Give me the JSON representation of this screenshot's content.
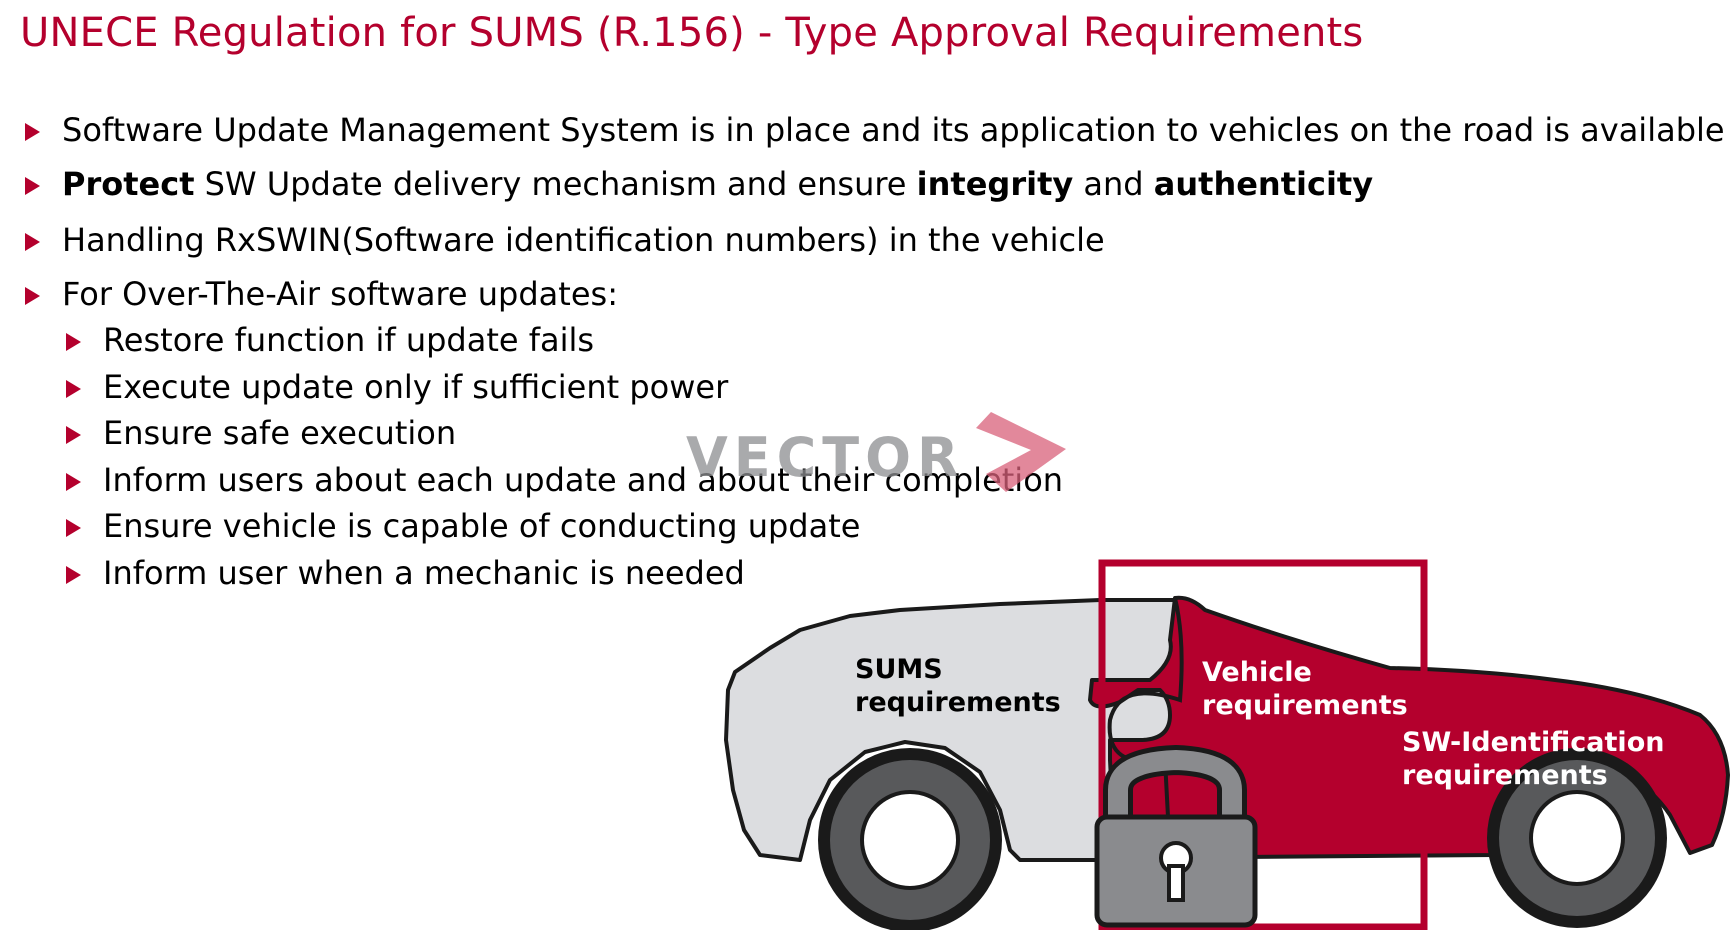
{
  "slide": {
    "title": "UNECE Regulation for SUMS (R.156) - Type Approval Requirements"
  },
  "bullets": {
    "b1": {
      "text": "Software Update Management System is in place and its application to vehicles on the road is available"
    },
    "b2": {
      "protect": "Protect",
      "mid": " SW Update delivery mechanism and ensure ",
      "integrity": "integrity",
      "and": " and ",
      "authenticity": "authenticity"
    },
    "b3": {
      "text": "Handling RxSWIN(Software identification numbers) in the vehicle"
    },
    "b4": {
      "text": "For Over-The-Air software updates:"
    }
  },
  "sub_bullets": [
    "Restore function if update fails",
    "Execute update only if sufficient power",
    "Ensure safe execution",
    "Inform users about each update and about their completion",
    "Ensure vehicle is capable of conducting update",
    "Inform user when a mechanic is needed"
  ],
  "watermark": {
    "text": "VECTOR"
  },
  "diagram": {
    "sums_label": [
      "SUMS",
      "requirements"
    ],
    "vehicle_label": [
      "Vehicle",
      "requirements"
    ],
    "swid_label": [
      "SW-Identification",
      "requirements"
    ]
  },
  "colors": {
    "brand_red": "#b4002d",
    "car_gray": "#dcdde0",
    "tire_dark": "#58595b",
    "lock_gray": "#8a8b8e"
  }
}
